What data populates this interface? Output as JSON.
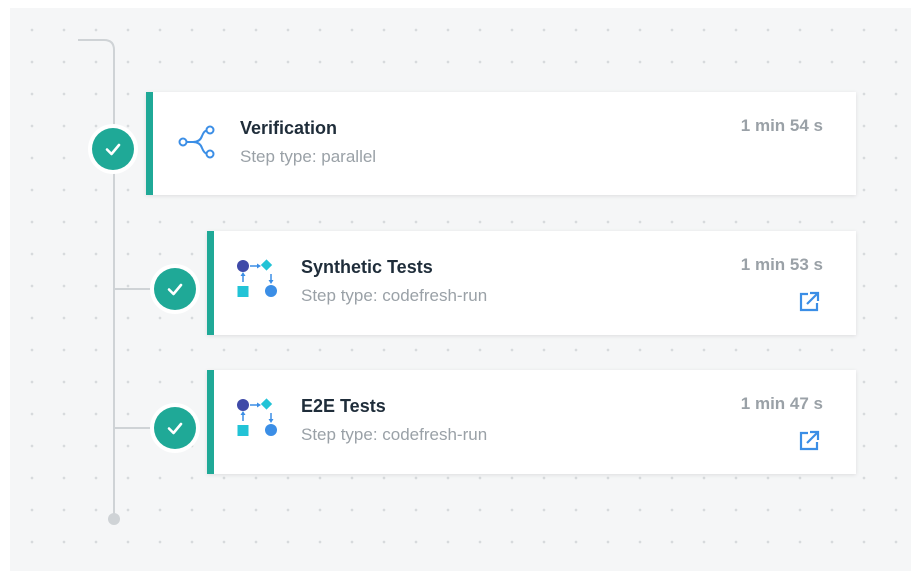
{
  "steps": [
    {
      "title": "Verification",
      "subtitle": "Step type: parallel",
      "duration": "1 min 54 s",
      "icon": "parallel-icon",
      "status": "success"
    },
    {
      "title": "Synthetic Tests",
      "subtitle": "Step type: codefresh-run",
      "duration": "1 min 53 s",
      "icon": "codefresh-run-icon",
      "status": "success",
      "link_icon": "external-link-icon"
    },
    {
      "title": "E2E Tests",
      "subtitle": "Step type: codefresh-run",
      "duration": "1 min 47 s",
      "icon": "codefresh-run-icon",
      "status": "success",
      "link_icon": "external-link-icon"
    }
  ],
  "colors": {
    "accent": "#1fa997",
    "title_text": "#1f2d3a",
    "muted_text": "#9aa1a7",
    "link": "#3b8ee6",
    "connector": "#cfd3d6"
  }
}
